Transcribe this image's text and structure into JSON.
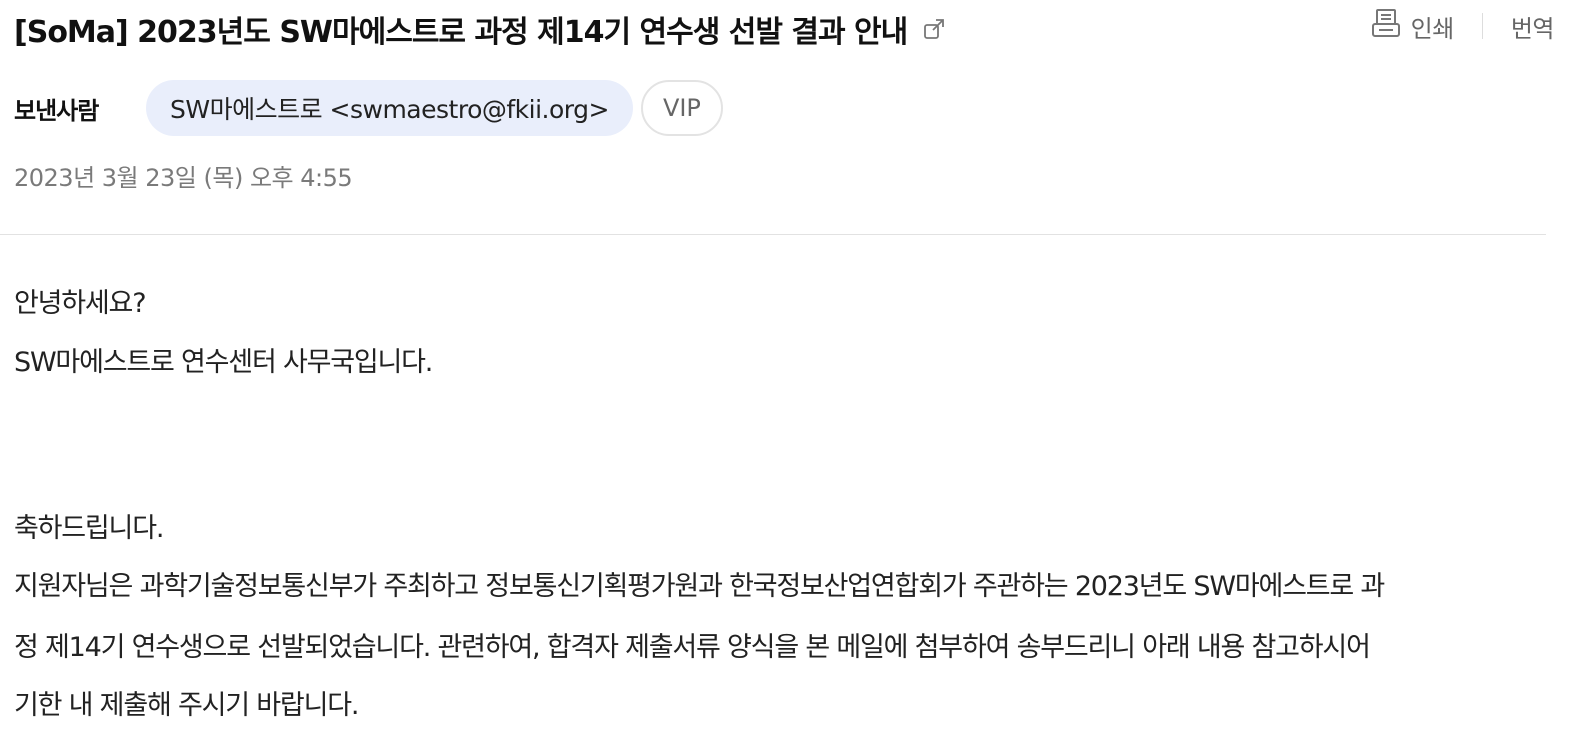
{
  "mail": {
    "subject": "[SoMa] 2023년도 SW마에스트로 과정 제14기 연수생 선발 결과 안내",
    "actions": {
      "print_label": "인쇄",
      "translate_label": "번역"
    },
    "sender": {
      "label": "보낸사람",
      "name_email": "SW마에스트로 <swmaestro@fkii.org>",
      "vip_label": "VIP"
    },
    "date": "2023년 3월 23일 (목) 오후 4:55",
    "body_lines": [
      "안녕하세요?",
      "SW마에스트로 연수센터 사무국입니다.",
      "축하드립니다.",
      "지원자님은 과학기술정보통신부가 주최하고 정보통신기획평가원과 한국정보산업연합회가 주관하는 2023년도 SW마에스트로 과",
      "정 제14기 연수생으로 선발되었습니다. 관련하여, 합격자 제출서류 양식을 본 메일에 첨부하여 송부드리니 아래 내용 참고하시어",
      "기한 내 제출해 주시기 바랍니다."
    ]
  }
}
